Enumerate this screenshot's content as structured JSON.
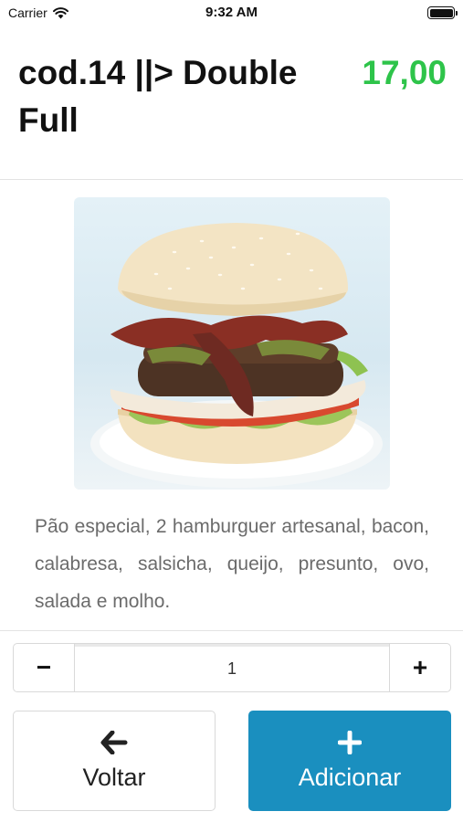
{
  "status_bar": {
    "carrier": "Carrier",
    "time": "9:32 AM"
  },
  "product": {
    "title": "cod.14 ||> Double Full",
    "price": "17,00",
    "price_color": "#2ec44a",
    "description": "Pão especial, 2 hamburguer artesanal, bacon, calabresa, salsicha, queijo, presunto, ovo, salada e molho."
  },
  "quantity": {
    "value": "1",
    "minus_symbol": "−",
    "plus_symbol": "+"
  },
  "actions": {
    "back_label": "Voltar",
    "back_icon": "arrow-left-icon",
    "add_label": "Adicionar",
    "add_icon": "plus-icon",
    "add_color": "#1a8fbf"
  }
}
